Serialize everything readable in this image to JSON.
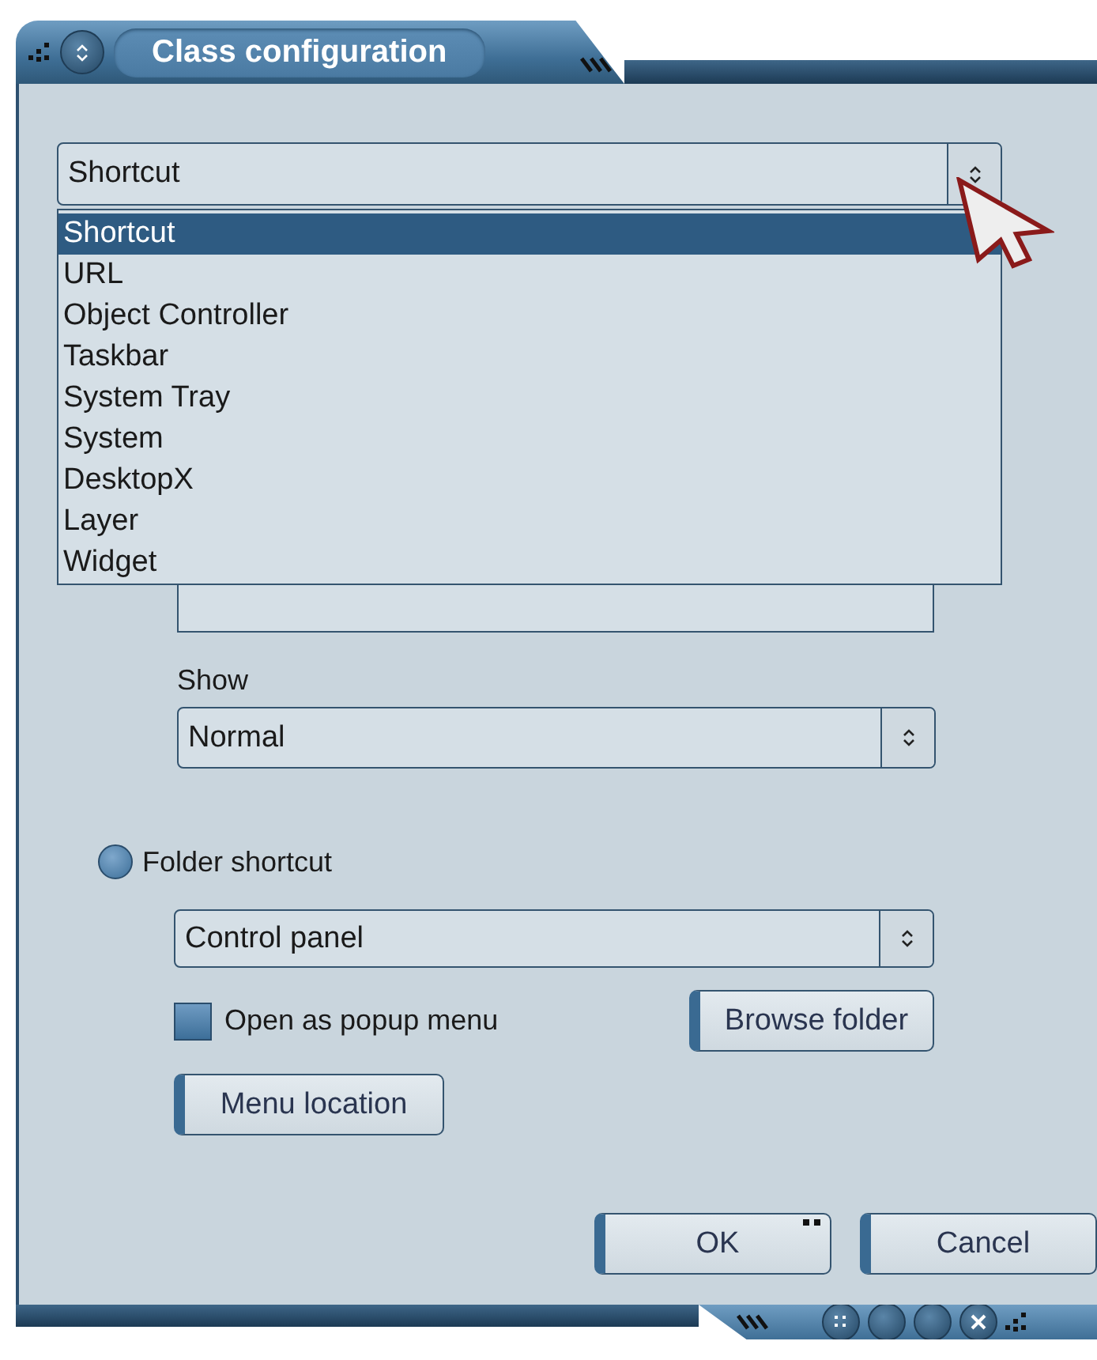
{
  "window": {
    "title": "Class configuration"
  },
  "class_select": {
    "value": "Shortcut",
    "expanded": true,
    "options": [
      {
        "label": "Shortcut",
        "selected": true
      },
      {
        "label": "URL",
        "selected": false
      },
      {
        "label": "Object Controller",
        "selected": false
      },
      {
        "label": "Taskbar",
        "selected": false
      },
      {
        "label": "System Tray",
        "selected": false
      },
      {
        "label": "System",
        "selected": false
      },
      {
        "label": "DesktopX",
        "selected": false
      },
      {
        "label": "Layer",
        "selected": false
      },
      {
        "label": "Widget",
        "selected": false
      }
    ]
  },
  "show": {
    "label": "Show",
    "value": "Normal"
  },
  "folder_shortcut": {
    "label": "Folder shortcut",
    "selected": false,
    "folder": "Control panel",
    "popup_menu": {
      "label": "Open as popup menu",
      "checked": false
    },
    "browse_button": {
      "label": "Browse folder",
      "default": false
    },
    "menu_button": {
      "label": "Menu location",
      "default": false
    }
  },
  "buttons": [
    {
      "label": "OK",
      "default": true
    },
    {
      "label": "Cancel",
      "default": false
    }
  ]
}
